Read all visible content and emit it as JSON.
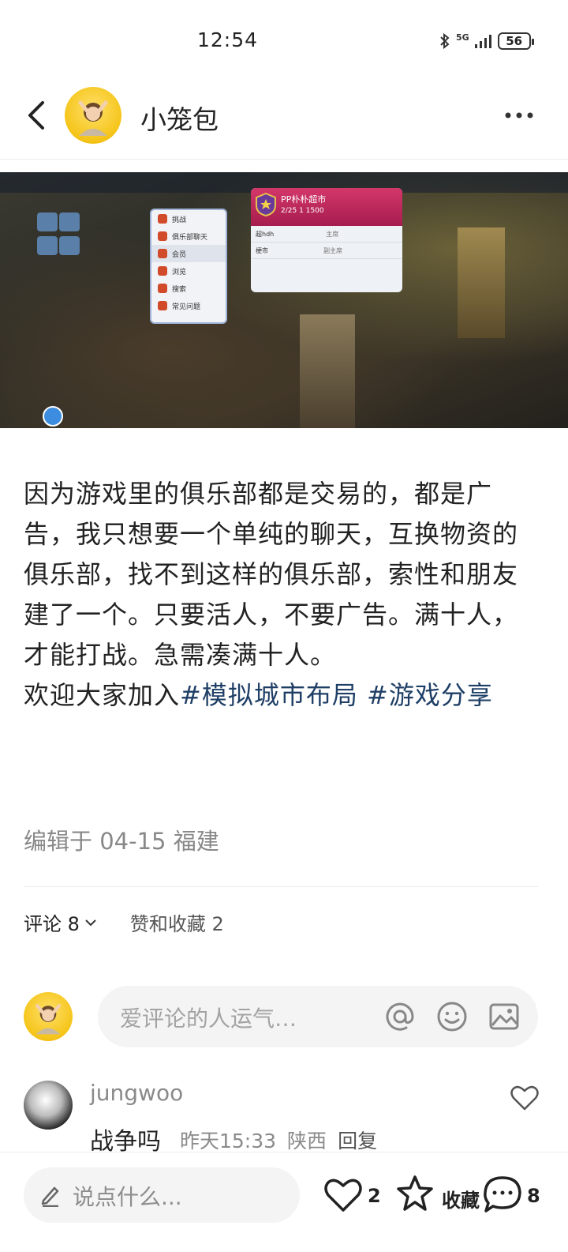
{
  "status": {
    "time": "12:54",
    "network": "5G",
    "battery": "56"
  },
  "header": {
    "author": "小笼包"
  },
  "game_screenshot": {
    "menu": [
      "挑战",
      "俱乐部聊天",
      "会员",
      "浏览",
      "搜索",
      "常见问题"
    ],
    "club": {
      "name": "PP朴朴超市",
      "stats": "2/25  1  1500",
      "members": [
        {
          "name": "超hdh",
          "role": "主席"
        },
        {
          "name": "梗市",
          "role": "副主席"
        }
      ]
    }
  },
  "post": {
    "paragraphs": [
      "因为游戏里的俱乐部都是交易的，都是广告，我只想要一个单纯的聊天，互换物资的俱乐部，找不到这样的俱乐部，索性和朋友建了一个。只要活人，不要广告。满十人，才能打战。急需凑满十人。"
    ],
    "invite": "欢迎大家加入",
    "tags": [
      "#模拟城市布局",
      "#游戏分享"
    ],
    "edited": "编辑于 04-15 福建"
  },
  "tabs": {
    "comments": "评论 8",
    "likes": "赞和收藏 2"
  },
  "comment_input": {
    "placeholder": "爱评论的人运气…"
  },
  "comments": [
    {
      "user": "jungwoo",
      "text": "战争吗",
      "time": "昨天15:33",
      "location": "陕西",
      "reply": "回复"
    }
  ],
  "bottom": {
    "placeholder": "说点什么...",
    "likes": "2",
    "collect": "收藏",
    "comments": "8"
  },
  "colors": {
    "tag": "#1f3f66",
    "accent": "#f5c418"
  }
}
